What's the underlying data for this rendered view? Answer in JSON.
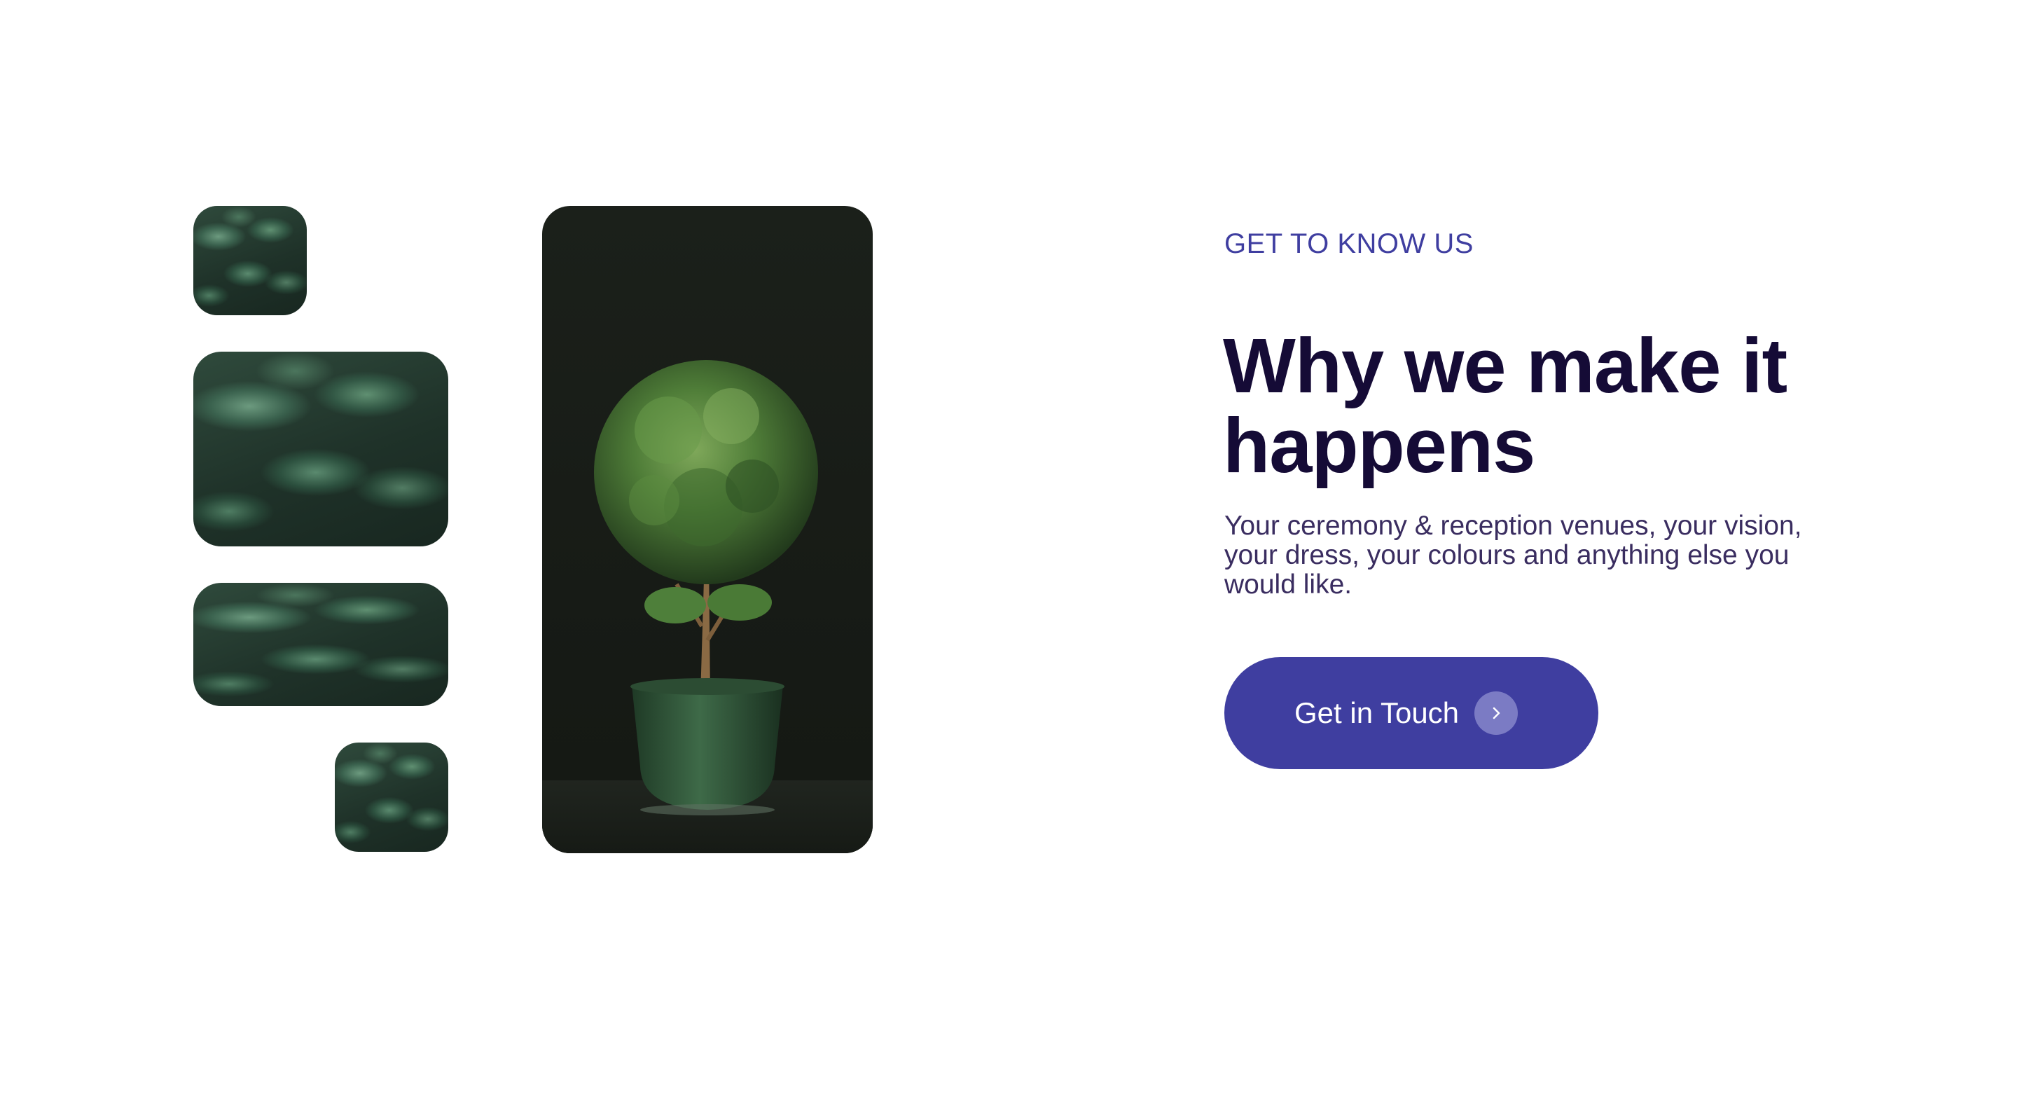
{
  "section": {
    "eyebrow": "GET TO KNOW US",
    "headline": "Why we make it happens",
    "body": "Your ceremony & reception venues, your vision, your dress, your colours and anything else you would like.",
    "cta_label": "Get in Touch"
  },
  "images": {
    "tiles": [
      "leaves-photo",
      "leaves-photo",
      "leaves-photo",
      "leaves-photo"
    ],
    "feature": "potted-topiary-plant-photo"
  },
  "icons": {
    "cta_icon": "chevron-right-icon"
  },
  "colors": {
    "accent": "#3f3ea0",
    "heading": "#150b36",
    "body": "#3a2d60",
    "button_icon_bg": "#7b7bc4",
    "background": "#ffffff"
  }
}
